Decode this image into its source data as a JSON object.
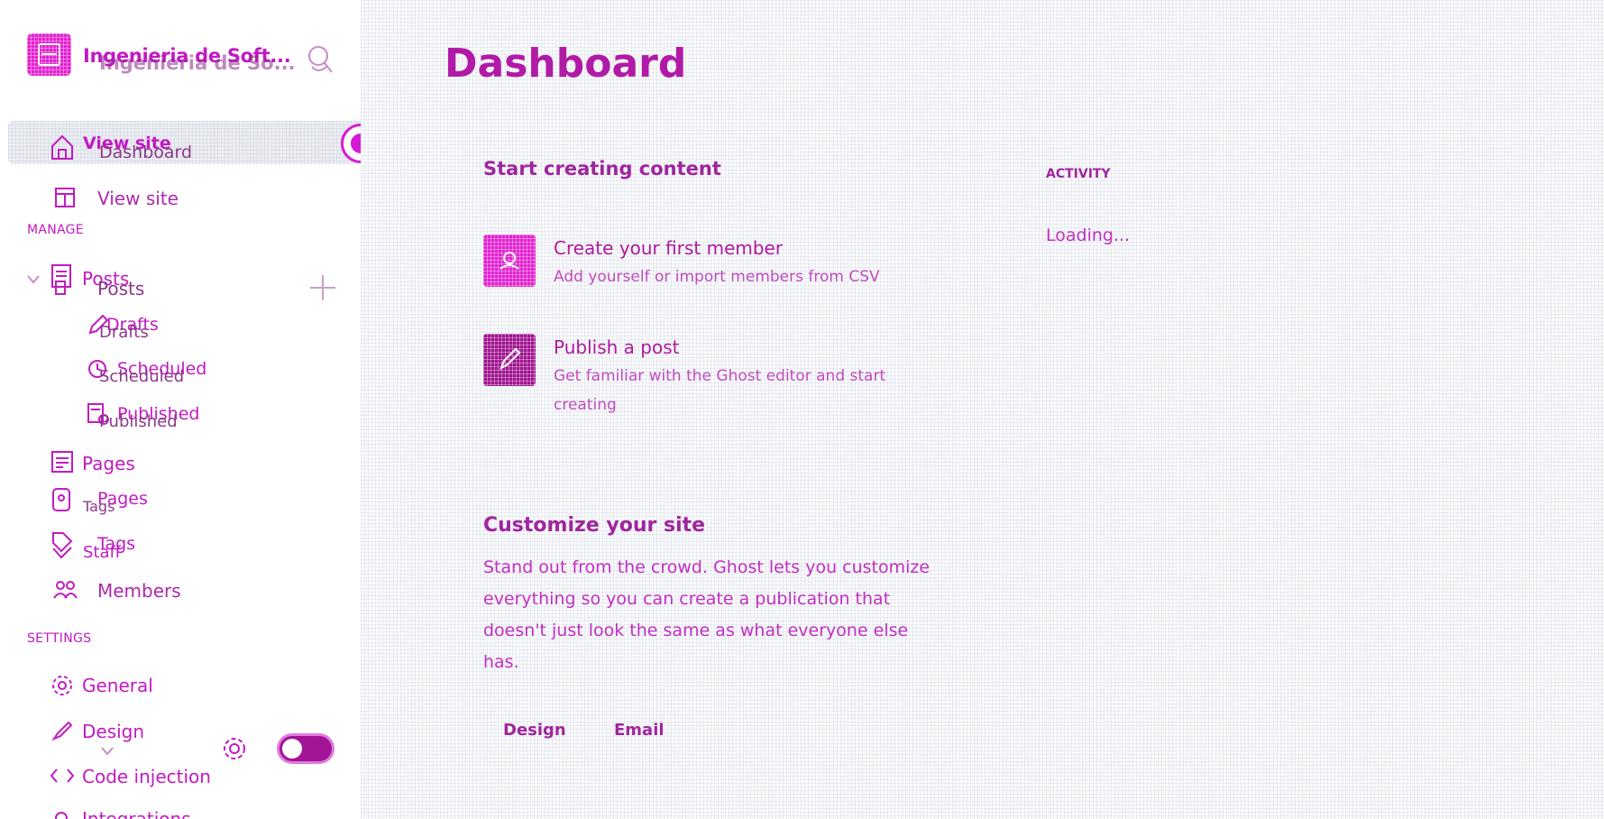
{
  "sidebar": {
    "brand_title": "Ingenieria de Soft...",
    "brand_title_overlay": "Ingenieria de So...",
    "nav_top": [
      {
        "label": "View site",
        "overlay": "Dashboard"
      },
      {
        "label": "View site"
      }
    ],
    "manage_label": "MANAGE",
    "posts": {
      "label": "Posts",
      "overlay": "Posts"
    },
    "subitems": [
      {
        "label": "Drafts",
        "overlay": "Drafts"
      },
      {
        "label": "Scheduled",
        "overlay": "Scheduled"
      },
      {
        "label": "Published",
        "overlay": "Published"
      }
    ],
    "pages": "Pages",
    "pages_overlay": "Pages",
    "tags_overlay_small": "Tags",
    "tags": "Tags",
    "staff": "Staff",
    "members": "Members",
    "settings_label": "SETTINGS",
    "settings_items": [
      "General",
      "Design",
      "Code injection",
      "Integrations"
    ]
  },
  "main": {
    "title": "Dashboard",
    "start": {
      "heading": "Start creating content",
      "rows": [
        {
          "title": "Create your first member",
          "desc": "Add yourself or import members from CSV",
          "color": "#e221cf"
        },
        {
          "title": "Publish a post",
          "desc": "Get familiar with the Ghost editor and start creating",
          "color": "#a0158f"
        }
      ]
    },
    "customize": {
      "heading": "Customize your site",
      "body": "Stand out from the crowd. Ghost lets you customize everything so you can create a publication that doesn't just look the same as what everyone else has.",
      "links": [
        "Design",
        "Email"
      ]
    },
    "activity": {
      "label": "ACTIVITY",
      "status": "Loading..."
    }
  }
}
